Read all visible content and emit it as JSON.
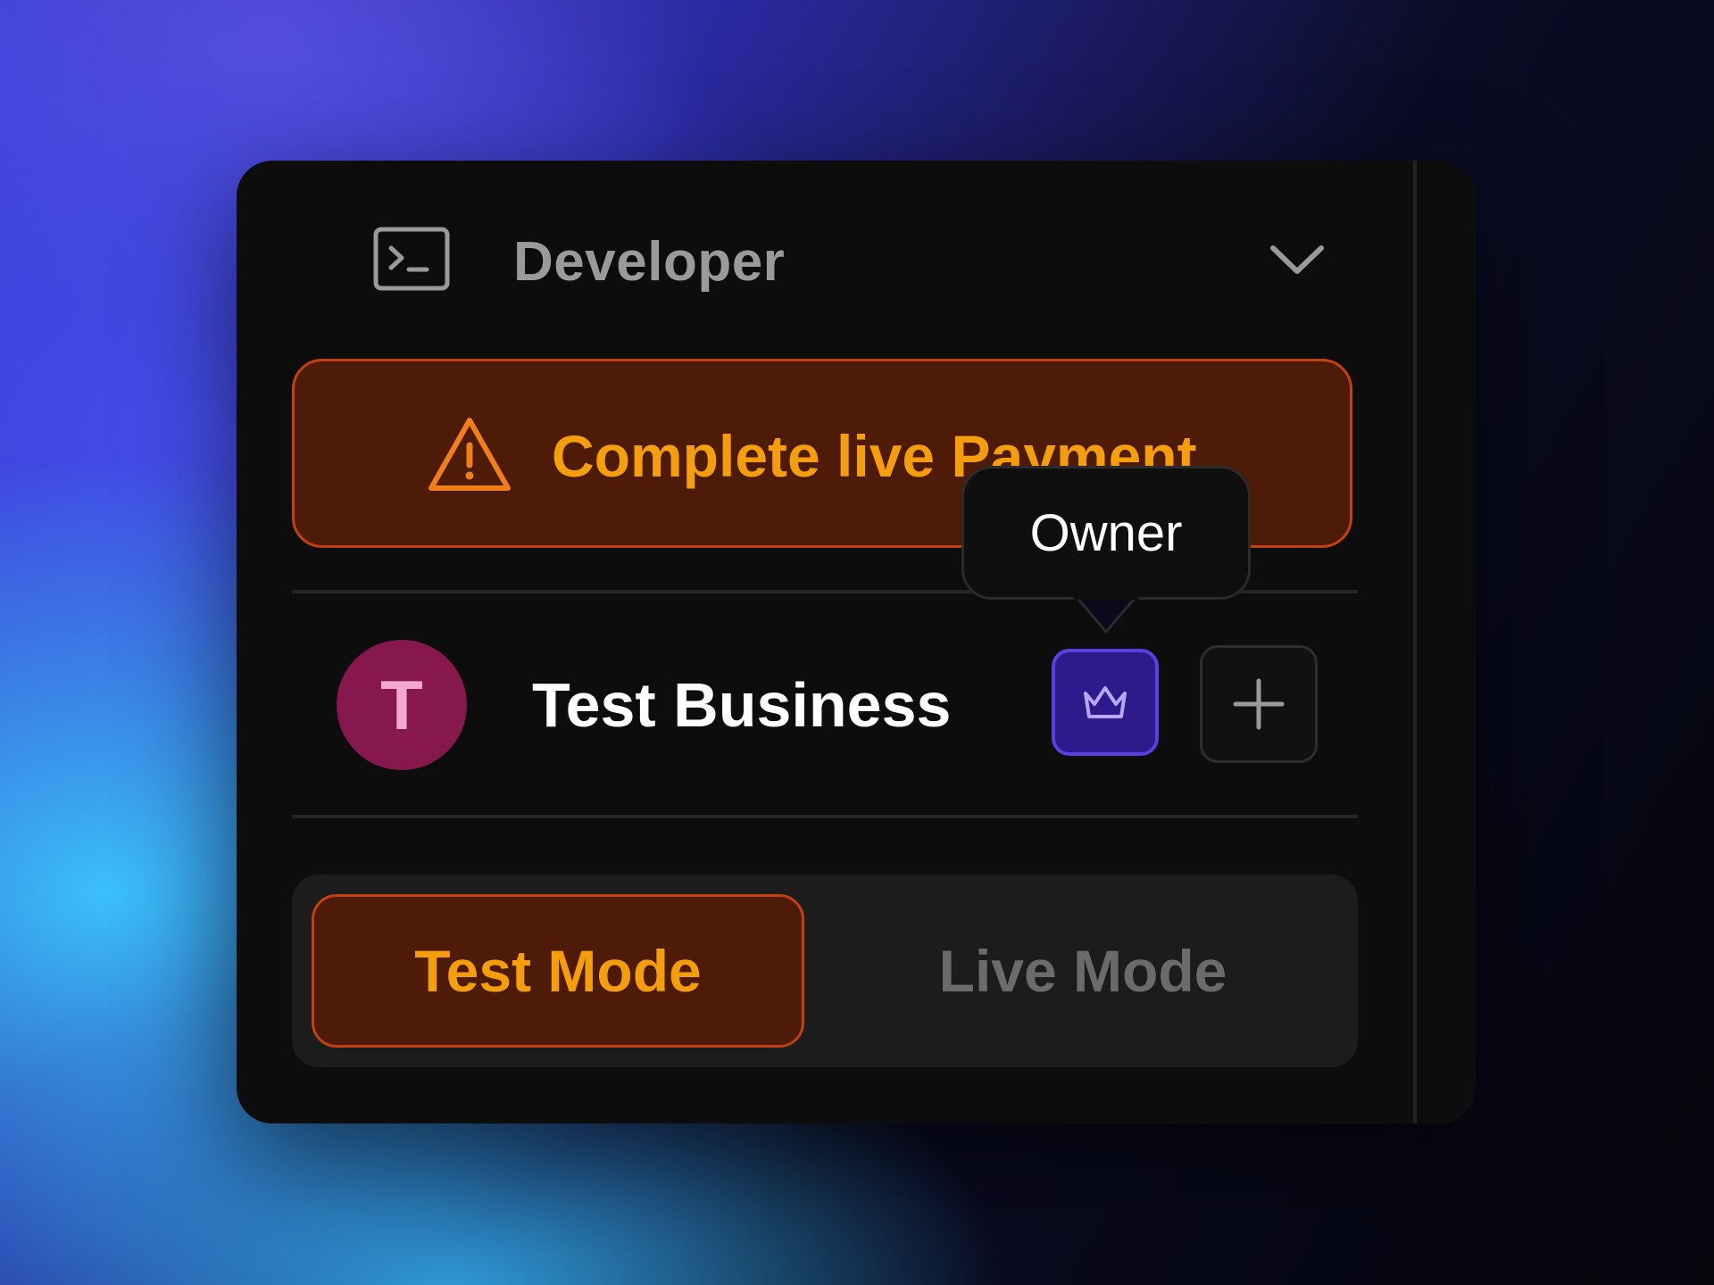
{
  "header": {
    "title": "Developer",
    "icon": "terminal-icon",
    "toggle_icon": "chevron-down-icon"
  },
  "alert": {
    "text": "Complete live Payment",
    "icon": "warning-icon",
    "color": "#f59e0b",
    "background": "#4d1b08"
  },
  "business": {
    "avatar_letter": "T",
    "name": "Test Business",
    "role_icon": "crown-icon",
    "add_icon": "plus-icon"
  },
  "tooltip": {
    "text": "Owner"
  },
  "mode": {
    "options": [
      "Test Mode",
      "Live Mode"
    ],
    "selected": "Test Mode"
  },
  "colors": {
    "accent_orange": "#f59e0b",
    "owner_purple": "#5b3fe0",
    "avatar": "#86184e"
  }
}
